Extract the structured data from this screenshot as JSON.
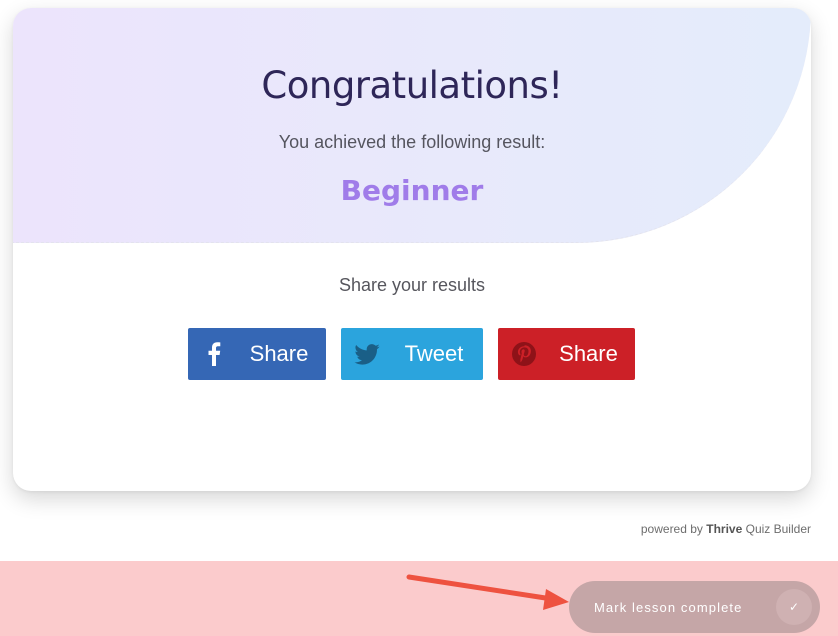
{
  "result_card": {
    "title": "Congratulations!",
    "subtitle": "You achieved the following result:",
    "result": "Beginner"
  },
  "share": {
    "heading": "Share your results",
    "buttons": [
      {
        "label": "Share",
        "icon": "facebook-icon",
        "color": "#3567b5"
      },
      {
        "label": "Tweet",
        "icon": "twitter-icon",
        "color": "#2ba4dd"
      },
      {
        "label": "Share",
        "icon": "pinterest-icon",
        "color": "#cc2027"
      }
    ]
  },
  "branding": {
    "prefix": "powered by",
    "brand": "Thrive",
    "product": "Quiz Builder"
  },
  "lesson": {
    "mark_complete_label": "Mark lesson complete",
    "check_icon": "check-icon",
    "annotation_arrow_color": "#ee5240"
  },
  "colors": {
    "hero_gradient_start": "#ece4fc",
    "hero_gradient_end": "#e4ecfb",
    "title": "#2e2658",
    "result": "#a07ce9",
    "footer_bg": "#fbcbcc",
    "mark_button_bg": "#c5a6a7"
  }
}
